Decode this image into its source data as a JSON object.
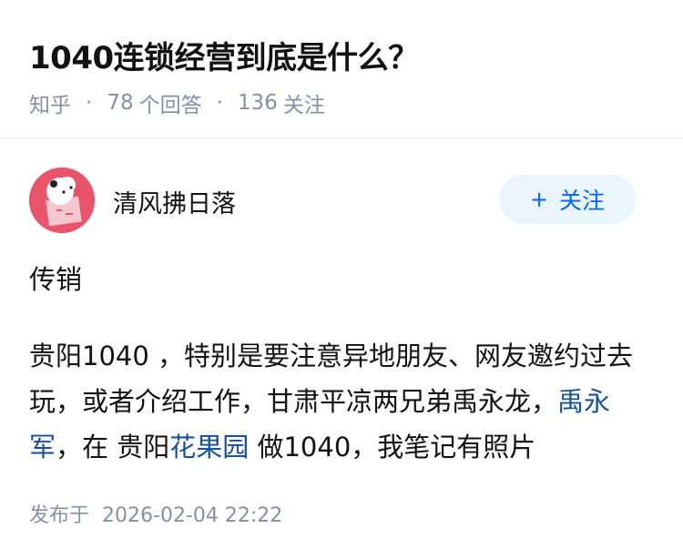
{
  "question": {
    "title": "1040连锁经营到底是什么？",
    "source": "知乎",
    "answer_count": "78",
    "answer_label": "个回答",
    "follow_count": "136",
    "follow_label": "关注"
  },
  "author": {
    "name": "清风拂日落",
    "follow_button": "关注",
    "follow_icon": "plus-icon"
  },
  "answer": {
    "p1": "传销",
    "p2_seg1": "贵阳1040 ，特别是要注意异地朋友、网友邀约过去玩，或者介绍工作，甘肃平凉两兄弟禹永龙，",
    "p2_link1": "禹永军",
    "p2_seg2": "，在 贵阳",
    "p2_link2": "花果园",
    "p2_seg3": " 做1040，我笔记有照片"
  },
  "footer": {
    "published_label": "发布于",
    "published_time": "2026-02-04 22:22"
  },
  "colors": {
    "accent": "#0066ff",
    "link": "#175199",
    "meta": "#8590a6",
    "avatar_bg": "#e8556a"
  }
}
